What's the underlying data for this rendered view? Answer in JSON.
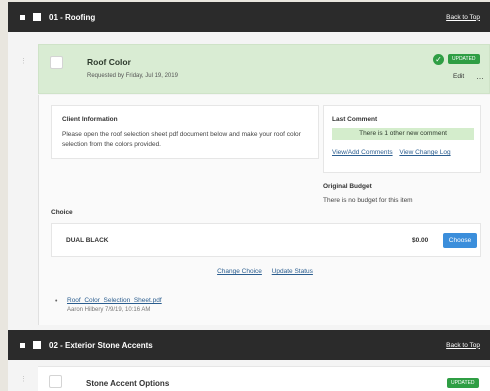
{
  "sections": [
    {
      "title": "01 - Roofing",
      "back_link": "Back to Top"
    },
    {
      "title": "02 - Exterior Stone Accents",
      "back_link": "Back to Top"
    }
  ],
  "item": {
    "title": "Roof Color",
    "requested_by": "Requested by Friday, Jul 19, 2019",
    "badge": "UPDATED",
    "edit": "Edit",
    "more": "…",
    "client_info_label": "Client Information",
    "client_info_text": "Please open the roof selection sheet pdf document below and make your roof color selection from the colors provided.",
    "last_comment_label": "Last Comment",
    "comment_notice": "There is 1 other new comment",
    "comment_links": [
      "View/Add Comments",
      "View Change Log"
    ],
    "original_budget_label": "Original Budget",
    "original_budget_text": "There is no budget for this item",
    "choice_label": "Choice",
    "choice": {
      "name": "DUAL BLACK",
      "price": "$0.00",
      "button": "Choose"
    },
    "actions": [
      "Change Choice",
      "Update Status"
    ],
    "attachment": {
      "name": "Roof_Color_Selection_Sheet.pdf",
      "meta": "Aaron Hilbery 7/9/19, 10:16 AM"
    }
  },
  "item2": {
    "title": "Stone Accent Options",
    "badge": "UPDATED"
  },
  "colors": {
    "accent_green": "#2f9e44",
    "highlight_green": "#d9ecd3",
    "button_blue": "#3b8edb",
    "header_dark": "#2b2b2b"
  }
}
